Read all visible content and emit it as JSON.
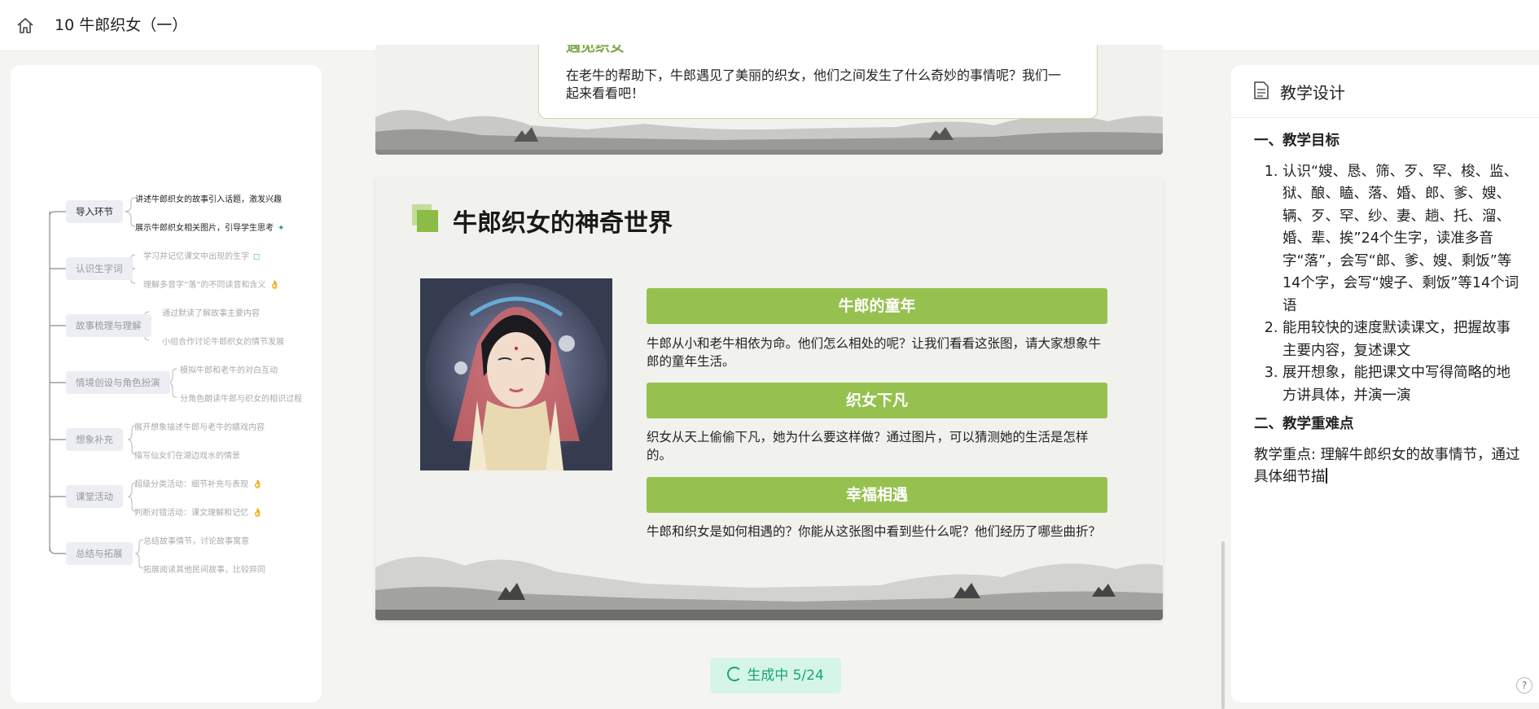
{
  "header": {
    "title": "10 牛郎织女（一）",
    "home_icon": "home-icon"
  },
  "mindmap": {
    "nodes": [
      {
        "label": "导入环节",
        "leaves": [
          "讲述牛郎织女的故事引入话题，激发兴趣",
          "展示牛郎织女相关图片，引导学生思考"
        ],
        "leaf_icons": [
          "",
          "✦"
        ]
      },
      {
        "label": "认识生字词",
        "leaves": [
          "学习并记忆课文中出现的生字",
          "理解多音字“落”的不同读音和含义"
        ],
        "leaf_icons": [
          "◻",
          "👌"
        ]
      },
      {
        "label": "故事梳理与理解",
        "leaves": [
          "通过默读了解故事主要内容",
          "小组合作讨论牛郎织女的情节发展"
        ],
        "leaf_icons": [
          "",
          ""
        ]
      },
      {
        "label": "情境创设与角色扮演",
        "leaves": [
          "模拟牛郎和老牛的对白互动",
          "分角色朗读牛郎与织女的相识过程"
        ],
        "leaf_icons": [
          "",
          ""
        ]
      },
      {
        "label": "想象补充",
        "leaves": [
          "展开想象描述牛郎与老牛的嬉戏内容",
          "描写仙女们在湖边戏水的情景"
        ],
        "leaf_icons": [
          "",
          ""
        ]
      },
      {
        "label": "课堂活动",
        "leaves": [
          "超级分类活动：细节补充与表现",
          "判断对错活动：课文理解和记忆"
        ],
        "leaf_icons": [
          "👌",
          "👌"
        ]
      },
      {
        "label": "总结与拓展",
        "leaves": [
          "总结故事情节，讨论故事寓意",
          "拓展阅读其他民间故事，比较异同"
        ],
        "leaf_icons": [
          "",
          ""
        ]
      }
    ]
  },
  "slide1": {
    "heading_cut": "遇见织女",
    "text": "在老牛的帮助下，牛郎遇见了美丽的织女，他们之间发生了什么奇妙的事情呢？我们一起来看看吧！"
  },
  "slide2": {
    "title": "牛郎织女的神奇世界",
    "sections": [
      {
        "heading": "牛郎的童年",
        "text": "牛郎从小和老牛相依为命。他们怎么相处的呢？让我们看看这张图，请大家想象牛郎的童年生活。"
      },
      {
        "heading": "织女下凡",
        "text": "织女从天上偷偷下凡，她为什么要这样做？通过图片，可以猜测她的生活是怎样的。"
      },
      {
        "heading": "幸福相遇",
        "text": "牛郎和织女是如何相遇的？你能从这张图中看到些什么呢？他们经历了哪些曲折？"
      }
    ],
    "accent": "#96c14f"
  },
  "status": {
    "label": "生成中 5/24",
    "color": "#17a673"
  },
  "right_panel": {
    "title": "教学设计",
    "icon": "document-icon",
    "section1": "一、教学目标",
    "goals": [
      "认识“嫂、恳、筛、歹、罕、梭、监、狱、酿、瞌、落、婚、郎、爹、嫂、辆、歹、罕、纱、妻、趟、托、溜、婚、辈、挨”24个生字，读准多音字“落”，会写“郎、爹、嫂、剩饭”等14个字，会写“嫂子、剩饭”等14个词语",
      "能用较快的速度默读课文，把握故事主要内容，复述课文",
      "展开想象，能把课文中写得简略的地方讲具体，并演一演"
    ],
    "section2": "二、教学重难点",
    "focus": "教学重点: 理解牛郎织女的故事情节，通过具体细节描"
  },
  "help_label": "?"
}
